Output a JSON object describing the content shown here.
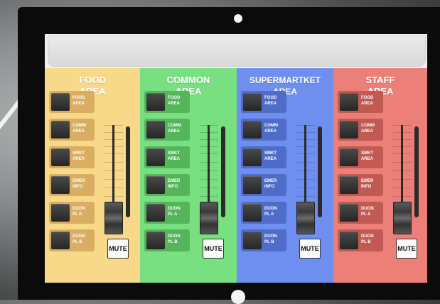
{
  "panels": [
    {
      "title_line1": "FOOD",
      "title_line2": "AREA",
      "color": "#f8d98a",
      "button_color": "#d9ae62",
      "buttons": [
        {
          "l1": "FOOD",
          "l2": "AREA"
        },
        {
          "l1": "COMM",
          "l2": "AREA"
        },
        {
          "l1": "SMKT",
          "l2": "AREA"
        },
        {
          "l1": "EMER",
          "l2": "INFO"
        },
        {
          "l1": "DUON",
          "l2": "PL A"
        },
        {
          "l1": "DUON",
          "l2": "PL B"
        }
      ],
      "mute_label": "MUTE"
    },
    {
      "title_line1": "COMMON",
      "title_line2": "AREA",
      "color": "#78e080",
      "button_color": "#54b55a",
      "buttons": [
        {
          "l1": "FOOD",
          "l2": "AREA"
        },
        {
          "l1": "COMM",
          "l2": "AREA"
        },
        {
          "l1": "SMKT",
          "l2": "AREA"
        },
        {
          "l1": "EMER",
          "l2": "INFO"
        },
        {
          "l1": "DUON",
          "l2": "PL A"
        },
        {
          "l1": "DUON",
          "l2": "PL B"
        }
      ],
      "mute_label": "MUTE"
    },
    {
      "title_line1": "SUPERMARTKET",
      "title_line2": "AREA",
      "color": "#6f8ff0",
      "button_color": "#4f6cc8",
      "buttons": [
        {
          "l1": "FOOD",
          "l2": "AREA"
        },
        {
          "l1": "COMM",
          "l2": "AREA"
        },
        {
          "l1": "SMKT",
          "l2": "AREA"
        },
        {
          "l1": "EMER",
          "l2": "INFO"
        },
        {
          "l1": "DUON",
          "l2": "PL A"
        },
        {
          "l1": "DUON",
          "l2": "PL B"
        }
      ],
      "mute_label": "MUTE"
    },
    {
      "title_line1": "STAFF",
      "title_line2": "AREA",
      "color": "#ec7f78",
      "button_color": "#c25a54",
      "buttons": [
        {
          "l1": "FOOD",
          "l2": "AREA"
        },
        {
          "l1": "COMM",
          "l2": "AREA"
        },
        {
          "l1": "SMKT",
          "l2": "AREA"
        },
        {
          "l1": "EMER",
          "l2": "INFO"
        },
        {
          "l1": "DUON",
          "l2": "PL A"
        },
        {
          "l1": "DUON",
          "l2": "PL B"
        }
      ],
      "mute_label": "MUTE"
    }
  ]
}
